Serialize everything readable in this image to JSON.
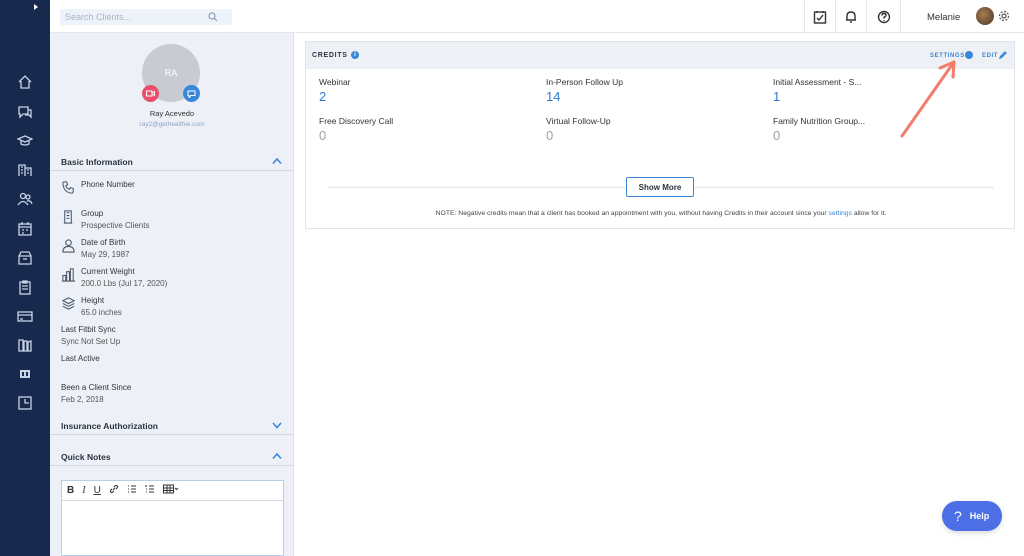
{
  "search": {
    "placeholder": "Search Clients..."
  },
  "header": {
    "user_name": "Melanie"
  },
  "client": {
    "initials": "RA",
    "name": "Ray Acevedo",
    "email": "ray2@gethealthie.com"
  },
  "basic_info": {
    "title": "Basic Information",
    "items": [
      {
        "label": "Phone Number",
        "value": "",
        "icon": "phone-icon"
      },
      {
        "label": "Group",
        "value": "Prospective Clients",
        "icon": "building-icon"
      },
      {
        "label": "Date of Birth",
        "value": "May 29, 1987",
        "icon": "user-icon"
      },
      {
        "label": "Current Weight",
        "value": "200.0 Lbs (Jul 17, 2020)",
        "icon": "bar-chart-icon"
      },
      {
        "label": "Height",
        "value": "65.0 inches",
        "icon": "stack-icon"
      },
      {
        "label": "Last Fitbit Sync",
        "value": "Sync Not Set Up"
      },
      {
        "label": "Last Active",
        "value": ""
      },
      {
        "label": "Been a Client Since",
        "value": "Feb 2, 2018"
      }
    ]
  },
  "insurance": {
    "title": "Insurance Authorization"
  },
  "notes": {
    "title": "Quick Notes",
    "toolbar": {
      "bold": "B",
      "italic": "I",
      "underline": "U"
    }
  },
  "credits": {
    "title": "CREDITS",
    "settings_label": "SETTINGS",
    "edit_label": "EDIT",
    "items": [
      {
        "name": "Webinar",
        "count": "2"
      },
      {
        "name": "In-Person Follow Up",
        "count": "14"
      },
      {
        "name": "Initial Assessment - S...",
        "count": "1"
      },
      {
        "name": "Free Discovery Call",
        "count": "0"
      },
      {
        "name": "Virtual Follow-Up",
        "count": "0"
      },
      {
        "name": "Family Nutrition Group...",
        "count": "0"
      }
    ],
    "show_more": "Show More",
    "note_prefix": "NOTE: Negative credits mean that a client has booked an appointment with you, without having Credits in their account since your",
    "note_link": "settings",
    "note_suffix": "allow for it."
  },
  "help": {
    "label": "Help",
    "glyph": "?"
  },
  "colors": {
    "rail": "#17294d",
    "accent": "#3a86d8",
    "video": "#ed4e6b",
    "help": "#4d6fe6",
    "annotation": "#f47c6a"
  }
}
